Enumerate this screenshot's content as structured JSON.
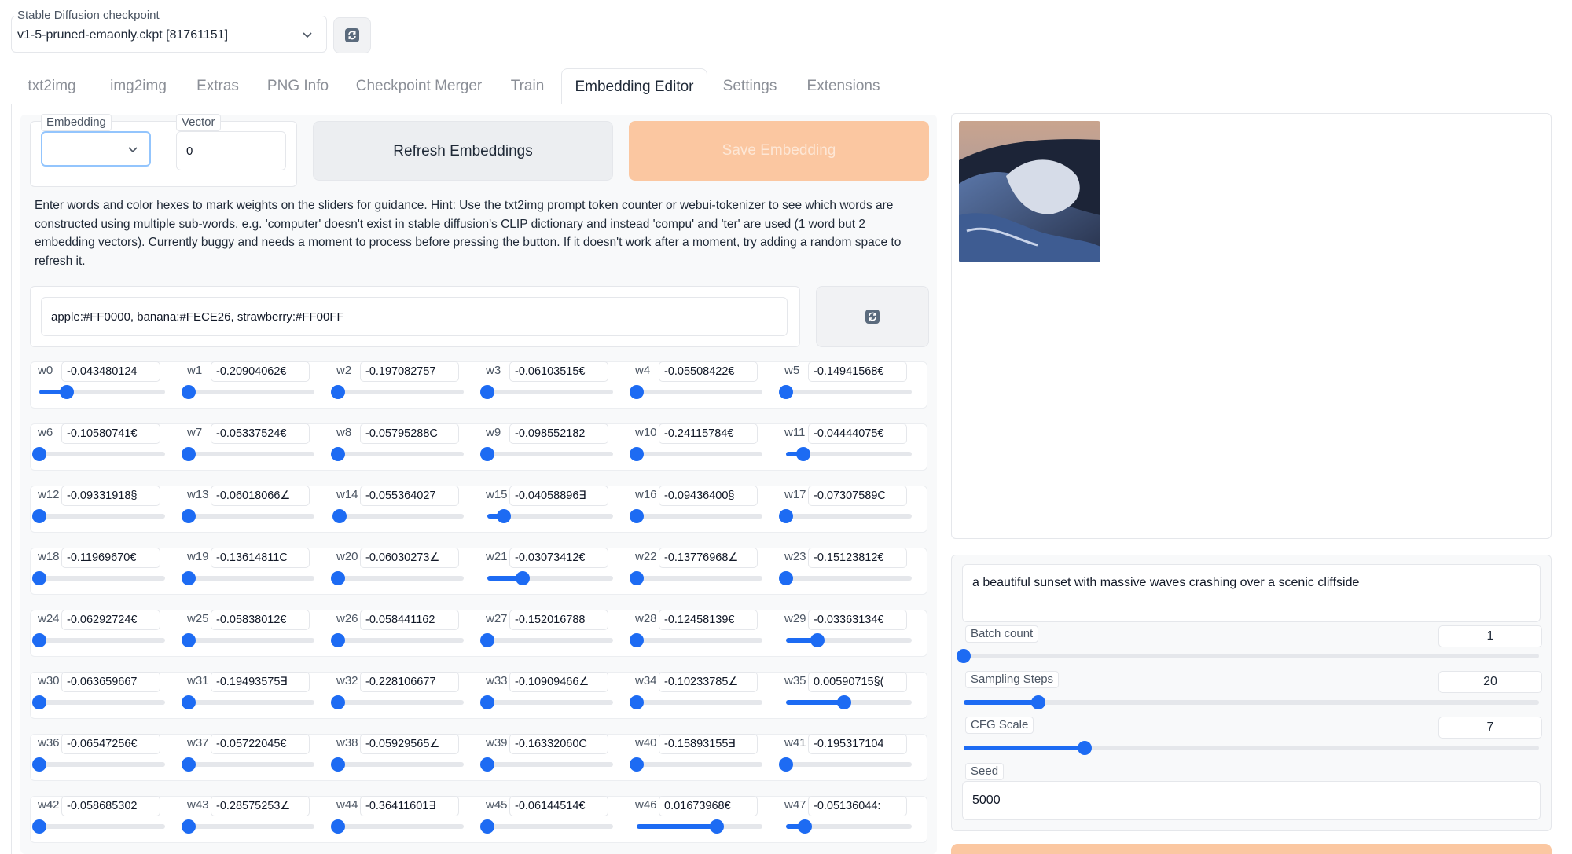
{
  "checkpoint": {
    "label": "Stable Diffusion checkpoint",
    "value": "v1-5-pruned-emaonly.ckpt [81761151]"
  },
  "tabs": [
    {
      "label": "txt2img",
      "active": false
    },
    {
      "label": "img2img",
      "active": false
    },
    {
      "label": "Extras",
      "active": false
    },
    {
      "label": "PNG Info",
      "active": false
    },
    {
      "label": "Checkpoint Merger",
      "active": false
    },
    {
      "label": "Train",
      "active": false
    },
    {
      "label": "Embedding Editor",
      "active": true
    },
    {
      "label": "Settings",
      "active": false
    },
    {
      "label": "Extensions",
      "active": false
    }
  ],
  "editor": {
    "embedding_label": "Embedding",
    "embedding_value": "",
    "vector_label": "Vector",
    "vector_value": "0",
    "refresh_label": "Refresh Embeddings",
    "save_label": "Save Embedding",
    "hint": "Enter words and color hexes to mark weights on the sliders for guidance. Hint: Use the txt2img prompt token counter or webui-tokenizer to see which words are constructed using multiple sub-words, e.g. 'computer' doesn't exist in stable diffusion's CLIP dictionary and instead 'compu' and 'ter' are used (1 word but 2 embedding vectors). Currently buggy and needs a moment to process before pressing the button. If it doesn't work after a moment, try adding a random space to refresh it.",
    "guidance_value": "apple:#FF0000, banana:#FECE26, strawberry:#FF00FF"
  },
  "weights": [
    {
      "name": "w0",
      "value": "-0.043480124",
      "pos": 0.22
    },
    {
      "name": "w1",
      "value": "-0.20904062€",
      "pos": 0.0
    },
    {
      "name": "w2",
      "value": "-0.197082757",
      "pos": 0.0
    },
    {
      "name": "w3",
      "value": "-0.06103515€",
      "pos": 0.0
    },
    {
      "name": "w4",
      "value": "-0.05508422€",
      "pos": 0.0
    },
    {
      "name": "w5",
      "value": "-0.14941568€",
      "pos": 0.0
    },
    {
      "name": "w6",
      "value": "-0.10580741€",
      "pos": 0.0
    },
    {
      "name": "w7",
      "value": "-0.05337524€",
      "pos": 0.0
    },
    {
      "name": "w8",
      "value": "-0.05795288C",
      "pos": 0.0
    },
    {
      "name": "w9",
      "value": "-0.098552182",
      "pos": 0.0
    },
    {
      "name": "w10",
      "value": "-0.24115784€",
      "pos": 0.0
    },
    {
      "name": "w11",
      "value": "-0.04444075€",
      "pos": 0.14
    },
    {
      "name": "w12",
      "value": "-0.09331918§",
      "pos": 0.0
    },
    {
      "name": "w13",
      "value": "-0.06018066∠",
      "pos": 0.0
    },
    {
      "name": "w14",
      "value": "-0.055364027",
      "pos": 0.01
    },
    {
      "name": "w15",
      "value": "-0.04058896∃",
      "pos": 0.13
    },
    {
      "name": "w16",
      "value": "-0.09436400§",
      "pos": 0.0
    },
    {
      "name": "w17",
      "value": "-0.07307589C",
      "pos": 0.0
    },
    {
      "name": "w18",
      "value": "-0.11969670€",
      "pos": 0.0
    },
    {
      "name": "w19",
      "value": "-0.13614811C",
      "pos": 0.0
    },
    {
      "name": "w20",
      "value": "-0.06030273∠",
      "pos": 0.0
    },
    {
      "name": "w21",
      "value": "-0.03073412€",
      "pos": 0.28
    },
    {
      "name": "w22",
      "value": "-0.13776968∠",
      "pos": 0.0
    },
    {
      "name": "w23",
      "value": "-0.15123812€",
      "pos": 0.0
    },
    {
      "name": "w24",
      "value": "-0.06292724€",
      "pos": 0.0
    },
    {
      "name": "w25",
      "value": "-0.05838012€",
      "pos": 0.0
    },
    {
      "name": "w26",
      "value": "-0.058441162",
      "pos": 0.0
    },
    {
      "name": "w27",
      "value": "-0.152016788",
      "pos": 0.0
    },
    {
      "name": "w28",
      "value": "-0.12458139€",
      "pos": 0.0
    },
    {
      "name": "w29",
      "value": "-0.03363134€",
      "pos": 0.25
    },
    {
      "name": "w30",
      "value": "-0.063659667",
      "pos": 0.0
    },
    {
      "name": "w31",
      "value": "-0.19493575∃",
      "pos": 0.0
    },
    {
      "name": "w32",
      "value": "-0.228106677",
      "pos": 0.0
    },
    {
      "name": "w33",
      "value": "-0.10909466∠",
      "pos": 0.0
    },
    {
      "name": "w34",
      "value": "-0.10233785∠",
      "pos": 0.0
    },
    {
      "name": "w35",
      "value": "0.00590715§(",
      "pos": 0.46
    },
    {
      "name": "w36",
      "value": "-0.06547256€",
      "pos": 0.0
    },
    {
      "name": "w37",
      "value": "-0.05722045€",
      "pos": 0.0
    },
    {
      "name": "w38",
      "value": "-0.05929565∠",
      "pos": 0.0
    },
    {
      "name": "w39",
      "value": "-0.16332060C",
      "pos": 0.0
    },
    {
      "name": "w40",
      "value": "-0.15893155∃",
      "pos": 0.0
    },
    {
      "name": "w41",
      "value": "-0.195317104",
      "pos": 0.0
    },
    {
      "name": "w42",
      "value": "-0.058685302",
      "pos": 0.0
    },
    {
      "name": "w43",
      "value": "-0.28575253∠",
      "pos": 0.0
    },
    {
      "name": "w44",
      "value": "-0.36411601∃",
      "pos": 0.0
    },
    {
      "name": "w45",
      "value": "-0.06144514€",
      "pos": 0.0
    },
    {
      "name": "w46",
      "value": "0.01673968€",
      "pos": 0.64
    },
    {
      "name": "w47",
      "value": "-0.05136044:",
      "pos": 0.15
    }
  ],
  "preview": {
    "prompt": "a beautiful sunset with massive waves crashing over a scenic cliffside",
    "batch_count_label": "Batch count",
    "batch_count": "1",
    "batch_fraction": 0.0,
    "steps_label": "Sampling Steps",
    "steps": "20",
    "steps_fraction": 0.13,
    "cfg_label": "CFG Scale",
    "cfg": "7",
    "cfg_fraction": 0.21,
    "seed_label": "Seed",
    "seed": "5000"
  },
  "colors": {
    "accent": "#1d6bf3",
    "save_button": "#fbc7a1",
    "track": "#e5e7eb"
  }
}
